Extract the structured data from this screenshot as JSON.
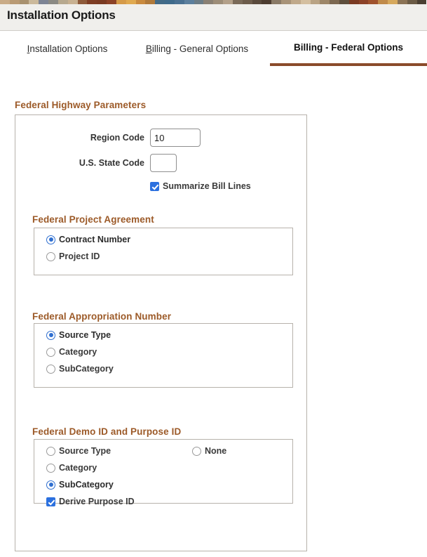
{
  "banner": {
    "name": "decorative-banner-strip",
    "colors": [
      "#c9ab87",
      "#b99a74",
      "#a8916f",
      "#cbb99b",
      "#7d8494",
      "#8b8a84",
      "#b7a98f",
      "#c8b191",
      "#8e5a3a",
      "#7e3d24",
      "#7a3a22",
      "#8c4227",
      "#d59a48",
      "#e0a94f",
      "#c98a3e",
      "#b0793a",
      "#436a86",
      "#3f6a8a",
      "#4a7091",
      "#5c7f9d",
      "#6b7c86",
      "#8a8073",
      "#9d8d78",
      "#b3a089",
      "#7a6a58",
      "#6d5c4b",
      "#5a4a3c",
      "#4d3c30",
      "#8a7a66",
      "#a89378",
      "#c0a98a",
      "#d4bfa0",
      "#b9a384",
      "#9d8668",
      "#7c6850",
      "#5e4e3c",
      "#7a3a22",
      "#8c4227",
      "#a0522d",
      "#c08a4a",
      "#d6a85c",
      "#8b7355",
      "#6b5b45",
      "#4a3f32"
    ]
  },
  "header": {
    "title": "Installation Options"
  },
  "tabs": [
    {
      "label": "Installation Options",
      "accesskey": "I",
      "rest": "nstallation Options",
      "active": false
    },
    {
      "label": "Billing - General Options",
      "accesskey": "B",
      "rest": "illing - General Options",
      "active": false
    },
    {
      "label": "Billing - Federal Options",
      "accesskey": "",
      "rest": "Billing - Federal Options",
      "active": true
    }
  ],
  "groups": {
    "highway": {
      "title": "Federal Highway Parameters",
      "fields": [
        {
          "label": "Region Code",
          "value": "10",
          "placeholder": ""
        },
        {
          "label": "U.S. State Code",
          "value": "",
          "placeholder": ""
        }
      ],
      "checkbox": {
        "label": "Summarize Bill Lines",
        "checked": true
      }
    },
    "project_agreement": {
      "title": "Federal Project Agreement",
      "options": [
        {
          "label": "Contract Number",
          "selected": true
        },
        {
          "label": "Project ID",
          "selected": false
        }
      ]
    },
    "appropriation": {
      "title": "Federal Appropriation Number",
      "options": [
        {
          "label": "Source Type",
          "selected": true
        },
        {
          "label": "Category",
          "selected": false
        },
        {
          "label": "SubCategory",
          "selected": false
        }
      ]
    },
    "demo_purpose": {
      "title": "Federal Demo ID and Purpose ID",
      "options": [
        {
          "label": "Source Type",
          "selected": false
        },
        {
          "label": "Category",
          "selected": false
        },
        {
          "label": "SubCategory",
          "selected": true
        }
      ],
      "options_right": [
        {
          "label": "None",
          "selected": false
        }
      ],
      "checkbox": {
        "label": "Derive Purpose ID",
        "checked": true
      }
    }
  },
  "colors": {
    "accent_brown": "#8a4b2a",
    "group_title": "#9c5a28",
    "header_bg": "#f0efec",
    "radio_blue": "#2f6fd0",
    "checkbox_blue": "#2b70df",
    "border_gray": "#b7b2ab"
  }
}
